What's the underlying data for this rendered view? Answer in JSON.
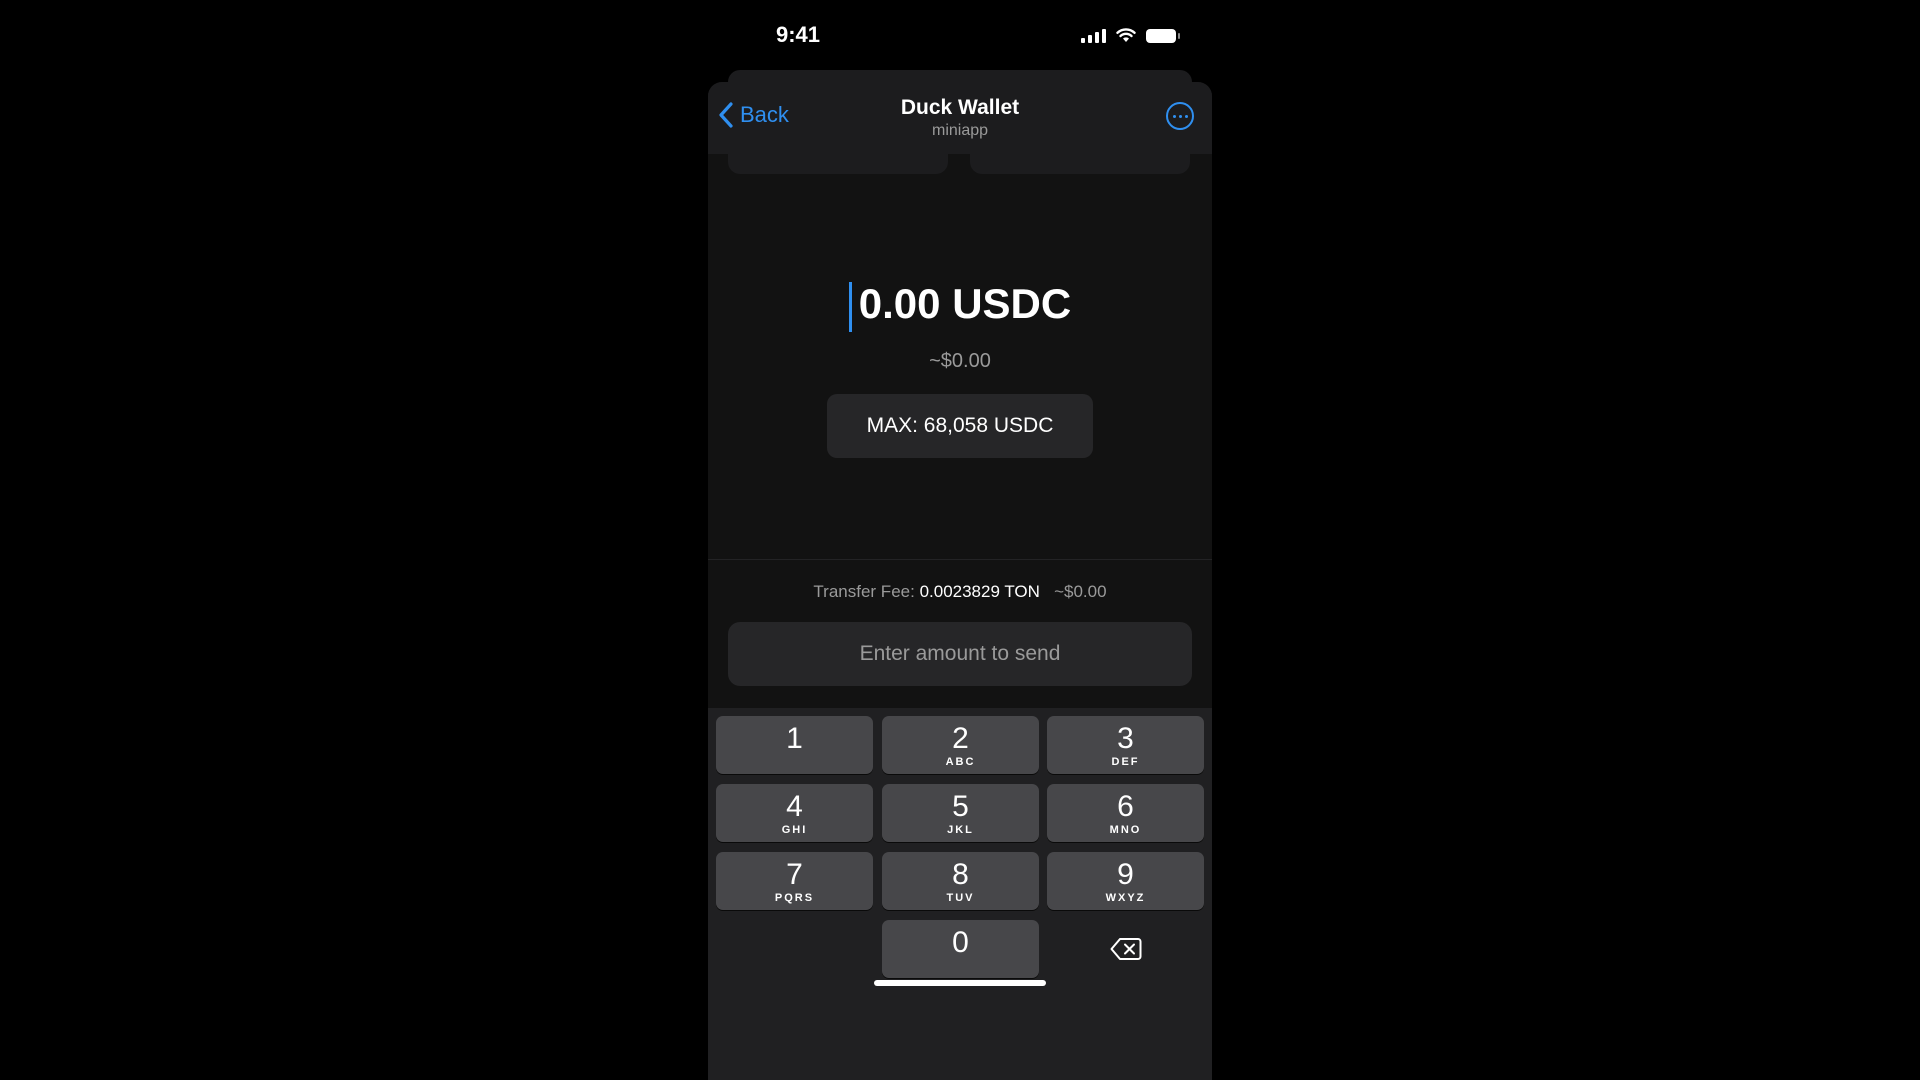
{
  "status_bar": {
    "time": "9:41"
  },
  "nav": {
    "back_label": "Back",
    "title": "Duck Wallet",
    "subtitle": "miniapp"
  },
  "amount": {
    "value": "0.00 USDC",
    "fiat": "~$0.00"
  },
  "max_button": {
    "label": "MAX: 68,058 USDC"
  },
  "fee": {
    "label": "Transfer Fee:",
    "value": "0.0023829 TON",
    "fiat": "~$0.00"
  },
  "send_button": {
    "label": "Enter amount to send"
  },
  "keypad": {
    "keys": [
      {
        "digit": "1",
        "letters": ""
      },
      {
        "digit": "2",
        "letters": "ABC"
      },
      {
        "digit": "3",
        "letters": "DEF"
      },
      {
        "digit": "4",
        "letters": "GHI"
      },
      {
        "digit": "5",
        "letters": "JKL"
      },
      {
        "digit": "6",
        "letters": "MNO"
      },
      {
        "digit": "7",
        "letters": "PQRS"
      },
      {
        "digit": "8",
        "letters": "TUV"
      },
      {
        "digit": "9",
        "letters": "WXYZ"
      },
      {
        "digit": "0",
        "letters": ""
      }
    ],
    "delete_icon": "delete-backspace-icon"
  },
  "colors": {
    "accent": "#2f8ff0",
    "background": "#000000",
    "sheet": "#121212",
    "key": "#47474a"
  }
}
